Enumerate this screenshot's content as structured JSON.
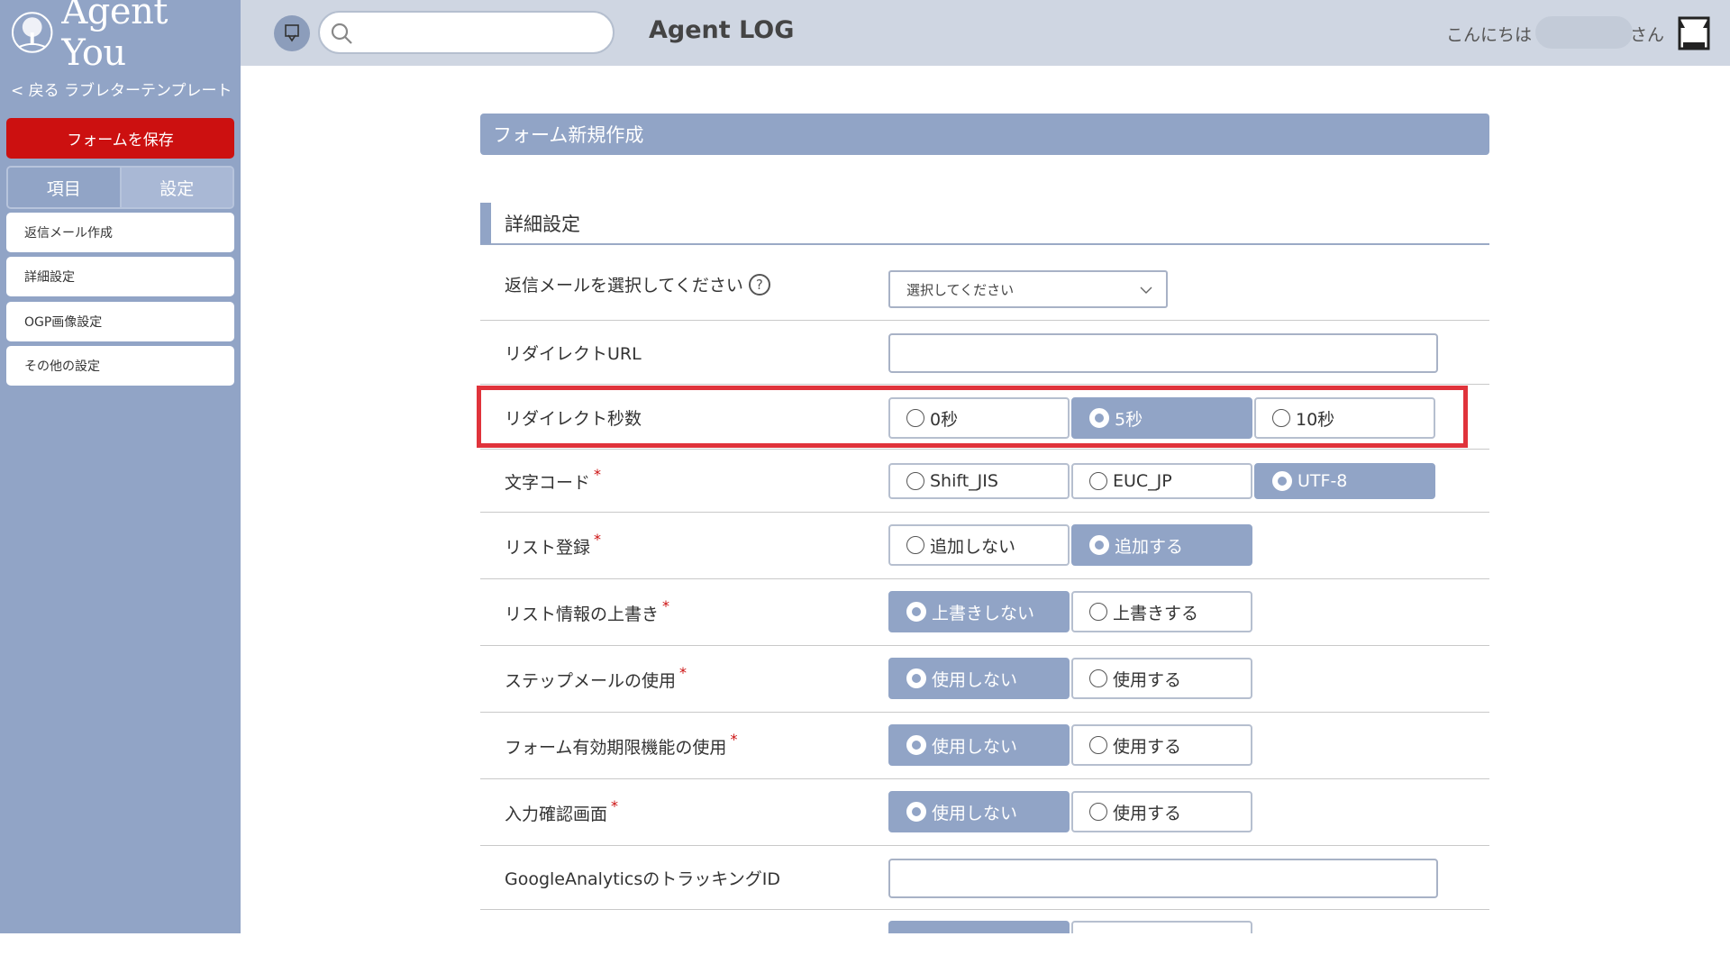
{
  "sidebar": {
    "logo_text": "Agent You",
    "back_link": "< 戻る ラブレターテンプレート",
    "save_button": "フォームを保存",
    "tabs": [
      "項目",
      "設定"
    ],
    "items": [
      "返信メール作成",
      "詳細設定",
      "OGP画像設定",
      "その他の設定"
    ]
  },
  "header": {
    "search": {
      "placeholder": ""
    },
    "app_title": "Agent LOG",
    "greeting": "こんにちは",
    "suffix": "さん"
  },
  "main": {
    "panel_title": "フォーム新規作成",
    "section_title": "詳細設定",
    "rows": {
      "reply_mail": {
        "label": "返信メールを選択してください",
        "help": "?",
        "value": "選択してください"
      },
      "redirect_url": {
        "label": "リダイレクトURL",
        "value": ""
      },
      "redirect_seconds": {
        "label": "リダイレクト秒数",
        "options": [
          "0秒",
          "5秒",
          "10秒"
        ],
        "selected": "5秒"
      },
      "charset": {
        "label": "文字コード",
        "required": "*",
        "options": [
          "Shift_JIS",
          "EUC_JP",
          "UTF-8"
        ],
        "selected": "UTF-8"
      },
      "list_register": {
        "label": "リスト登録",
        "required": "*",
        "options": [
          "追加しない",
          "追加する"
        ],
        "selected": "追加する"
      },
      "list_overwrite": {
        "label": "リスト情報の上書き",
        "required": "*",
        "options": [
          "上書きしない",
          "上書きする"
        ],
        "selected": "上書きしない"
      },
      "step_mail": {
        "label": "ステップメールの使用",
        "required": "*",
        "options": [
          "使用しない",
          "使用する"
        ],
        "selected": "使用しない"
      },
      "form_expiry": {
        "label": "フォーム有効期限機能の使用",
        "required": "*",
        "options": [
          "使用しない",
          "使用する"
        ],
        "selected": "使用しない"
      },
      "confirm_screen": {
        "label": "入力確認画面",
        "required": "*",
        "options": [
          "使用しない",
          "使用する"
        ],
        "selected": "使用しない"
      },
      "ga_tracking": {
        "label": "GoogleAnalyticsのトラッキングID",
        "value": ""
      }
    }
  },
  "colors": {
    "accent": "#91a4c6",
    "save": "#cc1010",
    "highlight": "#e0333b",
    "header_bg": "#cfd6e2"
  }
}
